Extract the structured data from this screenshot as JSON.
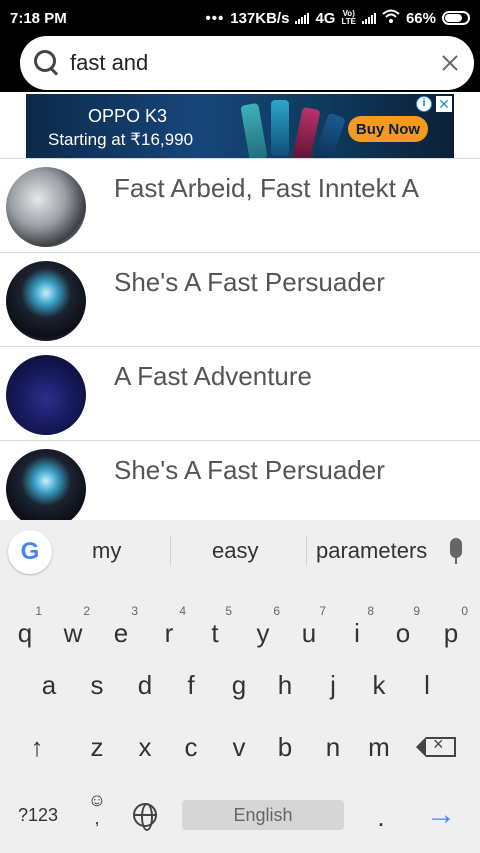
{
  "status_bar": {
    "time": "7:18 PM",
    "network_speed": "137KB/s",
    "network_type": "4G",
    "volte": "Vo) LTE",
    "battery": "66%",
    "icons": [
      "signal-icon",
      "wifi-icon",
      "battery-icon"
    ]
  },
  "search": {
    "query": "fast and",
    "search_icon": "search-icon",
    "clear_icon": "close-icon"
  },
  "ad": {
    "title": "OPPO K3",
    "price_text": "Starting at ₹16,990",
    "cta": "Buy Now",
    "info_icon": "i",
    "close_icon": "✕",
    "phone_colors": [
      "#2f8f9a",
      "#1b6d8f",
      "#7a1d4a",
      "#0d3f6c"
    ]
  },
  "results": [
    {
      "title": "Fast Arbeid, Fast Inntekt A"
    },
    {
      "title": "She's A Fast Persuader"
    },
    {
      "title": "A Fast Adventure"
    },
    {
      "title": "She's A Fast Persuader"
    }
  ],
  "keyboard": {
    "suggestions": [
      "my",
      "easy",
      "parameters"
    ],
    "space_label": "English",
    "symbols_label": "?123",
    "period_label": ".",
    "comma_label": ",",
    "emoji_label": "☺",
    "enter_label": "→",
    "shift_label": "↑",
    "row1": [
      {
        "key": "q",
        "hint": "1"
      },
      {
        "key": "w",
        "hint": "2"
      },
      {
        "key": "e",
        "hint": "3"
      },
      {
        "key": "r",
        "hint": "4"
      },
      {
        "key": "t",
        "hint": "5"
      },
      {
        "key": "y",
        "hint": "6"
      },
      {
        "key": "u",
        "hint": "7"
      },
      {
        "key": "i",
        "hint": "8"
      },
      {
        "key": "o",
        "hint": "9"
      },
      {
        "key": "p",
        "hint": "0"
      }
    ],
    "row2": [
      "a",
      "s",
      "d",
      "f",
      "g",
      "h",
      "j",
      "k",
      "l"
    ],
    "row3": [
      "z",
      "x",
      "c",
      "v",
      "b",
      "n",
      "m"
    ],
    "accent_color": "#4285f4"
  }
}
